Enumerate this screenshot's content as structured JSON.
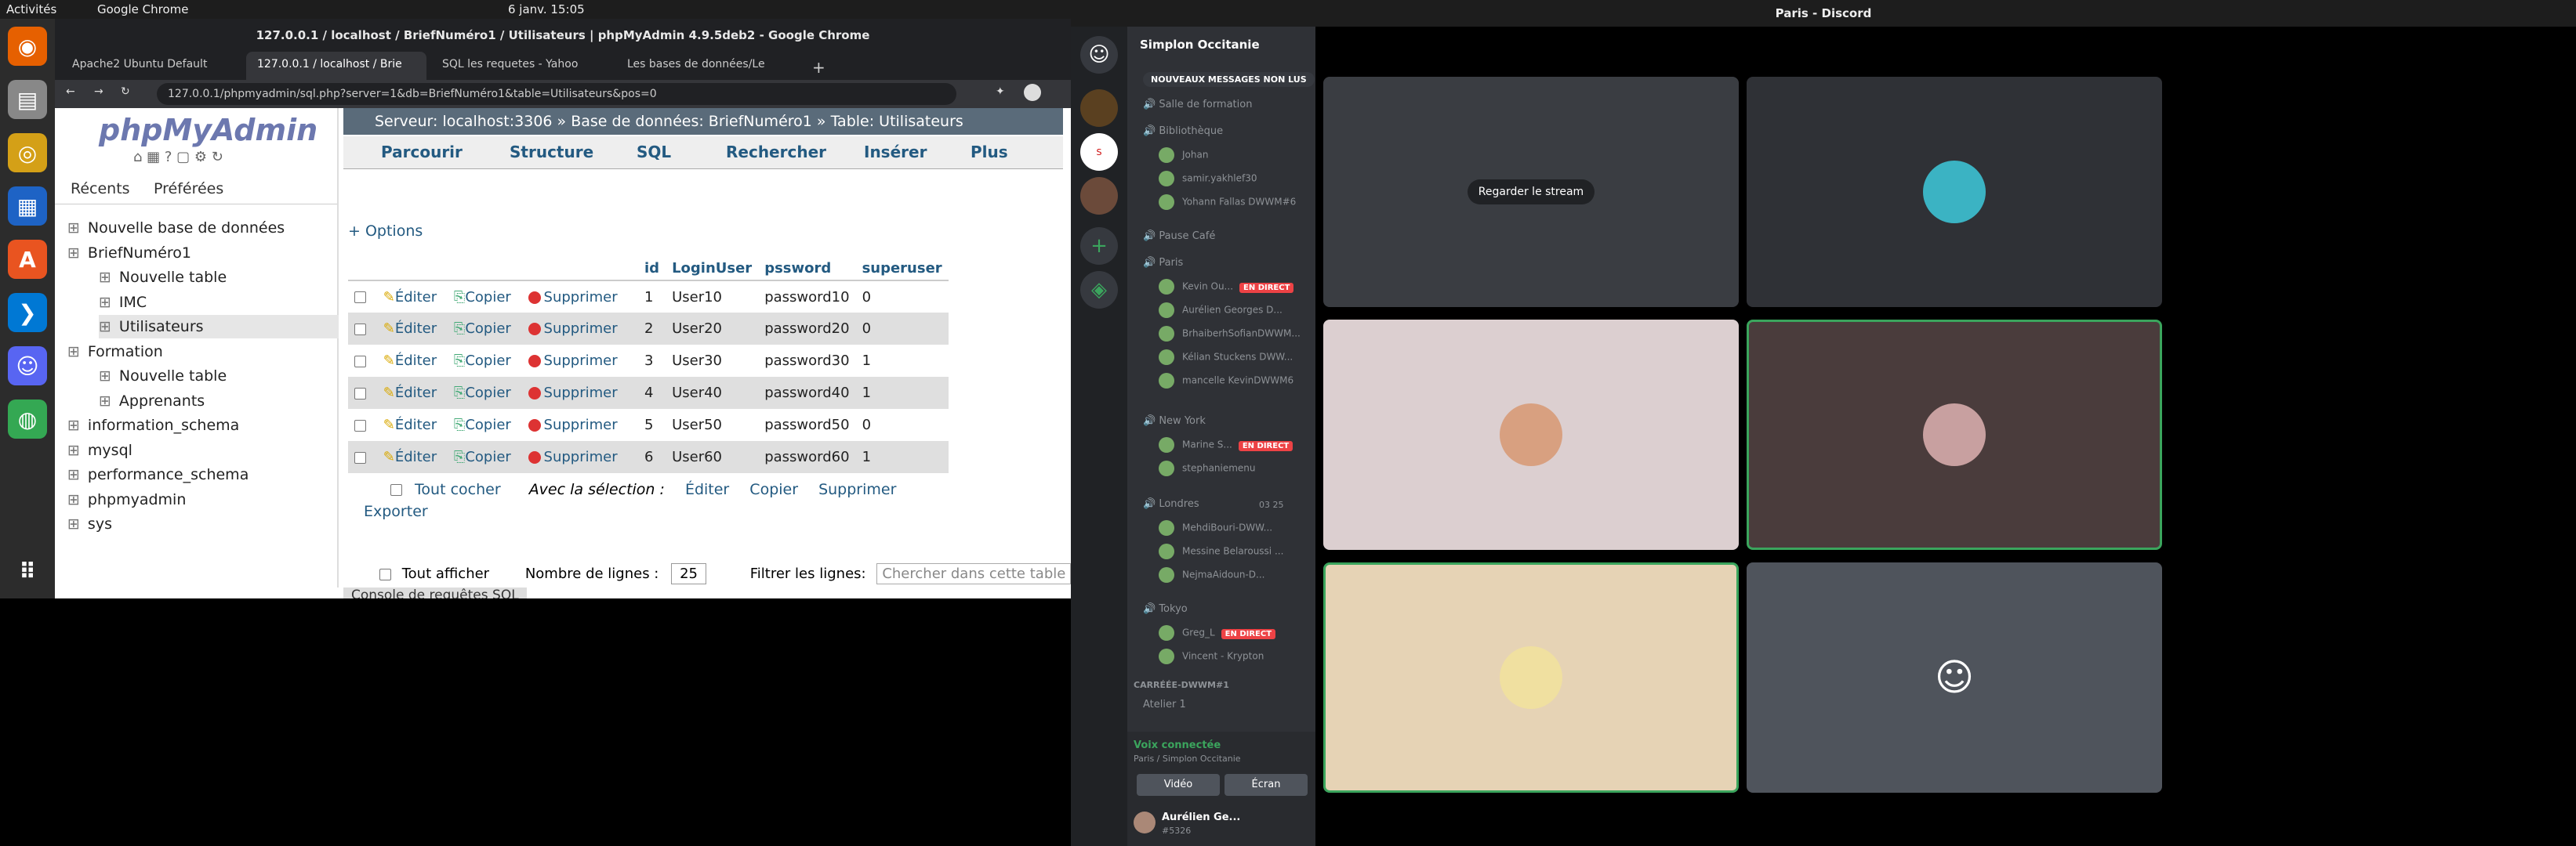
{
  "os": {
    "activities": "Activités",
    "app": "Google Chrome",
    "clock": "6 janv. 15:05"
  },
  "chrome": {
    "title": "127.0.0.1 / localhost / BriefNuméro1 / Utilisateurs | phpMyAdmin 4.9.5deb2 - Google Chrome",
    "tabs": [
      "Apache2 Ubuntu Default",
      "127.0.0.1 / localhost / Brie",
      "SQL les requetes - Yahoo",
      "Les bases de données/Le"
    ],
    "url": "127.0.0.1/phpmyadmin/sql.php?server=1&db=BriefNuméro1&table=Utilisateurs&pos=0"
  },
  "pma": {
    "logo": "phpMyAdmin",
    "recent": "Récents",
    "fav": "Préférées",
    "tree": [
      {
        "label": "Nouvelle base de données",
        "indent": 0
      },
      {
        "label": "BriefNuméro1",
        "indent": 0
      },
      {
        "label": "Nouvelle table",
        "indent": 1
      },
      {
        "label": "IMC",
        "indent": 1
      },
      {
        "label": "Utilisateurs",
        "indent": 1
      },
      {
        "label": "Formation",
        "indent": 0
      },
      {
        "label": "Nouvelle table",
        "indent": 1
      },
      {
        "label": "Apprenants",
        "indent": 1
      },
      {
        "label": "information_schema",
        "indent": 0
      },
      {
        "label": "mysql",
        "indent": 0
      },
      {
        "label": "performance_schema",
        "indent": 0
      },
      {
        "label": "phpmyadmin",
        "indent": 0
      },
      {
        "label": "sys",
        "indent": 0
      }
    ],
    "breadcrumb": {
      "server": "Serveur: localhost:3306",
      "db": "Base de données: BriefNuméro1",
      "table": "Table: Utilisateurs"
    },
    "tabs": [
      "Parcourir",
      "Structure",
      "SQL",
      "Rechercher",
      "Insérer",
      "Plus"
    ],
    "options": "+ Options",
    "columns": [
      "id",
      "LoginUser",
      "pssword",
      "superuser"
    ],
    "actions": {
      "edit": "Éditer",
      "copy": "Copier",
      "delete": "Supprimer"
    },
    "rows": [
      {
        "id": "1",
        "login": "User10",
        "pw": "password10",
        "su": "0"
      },
      {
        "id": "2",
        "login": "User20",
        "pw": "password20",
        "su": "0"
      },
      {
        "id": "3",
        "login": "User30",
        "pw": "password30",
        "su": "1"
      },
      {
        "id": "4",
        "login": "User40",
        "pw": "password40",
        "su": "1"
      },
      {
        "id": "5",
        "login": "User50",
        "pw": "password50",
        "su": "0"
      },
      {
        "id": "6",
        "login": "User60",
        "pw": "password60",
        "su": "1"
      }
    ],
    "checkall": "Tout cocher",
    "with_sel": "Avec la sélection :",
    "export": "Exporter",
    "showall": "Tout afficher",
    "nb_rows_label": "Nombre de lignes :",
    "nb_rows": "25",
    "filter_label": "Filtrer les lignes:",
    "filter_ph": "Chercher dans cette table",
    "console": "Console de requêtes SQL"
  },
  "discord": {
    "title": "Paris - Discord",
    "server": "Simplon Occitanie",
    "new_msgs": "NOUVEAUX MESSAGES NON LUS",
    "channels": {
      "formation": "Salle de formation",
      "biblio": "Bibliothèque",
      "pause": "Pause Café",
      "paris": "Paris",
      "ny": "New York",
      "londres": "Londres",
      "tokyo": "Tokyo",
      "category": "CARRÉÉE-DWWM#1",
      "atelier": "Atelier 1"
    },
    "biblio_users": [
      "Johan",
      "samir.yakhlef30",
      "Yohann Fallas DWWM#6"
    ],
    "paris_users": [
      "Kevin Ou...",
      "Aurélien Georges D...",
      "BrhaiberhSofianDWWM...",
      "Kélian Stuckens DWW...",
      "mancelle KevinDWWM6"
    ],
    "ny_users": [
      "Marine S...",
      "stephaniemenu"
    ],
    "londres_users": [
      "MehdiBouri-DWW...",
      "Messine Belaroussi ...",
      "NejmaAidoun-D..."
    ],
    "londres_count": "03",
    "londres_max": "25",
    "tokyo_users": [
      "Greg_L",
      "Vincent - Krypton"
    ],
    "live": "EN DIRECT",
    "voice": "Voix connectée",
    "voice_sub": "Paris / Simplon Occitanie",
    "video": "Vidéo",
    "screen": "Écran",
    "user": "Aurélien Ge...",
    "tag": "#5326",
    "watch": "Regarder le stream"
  }
}
